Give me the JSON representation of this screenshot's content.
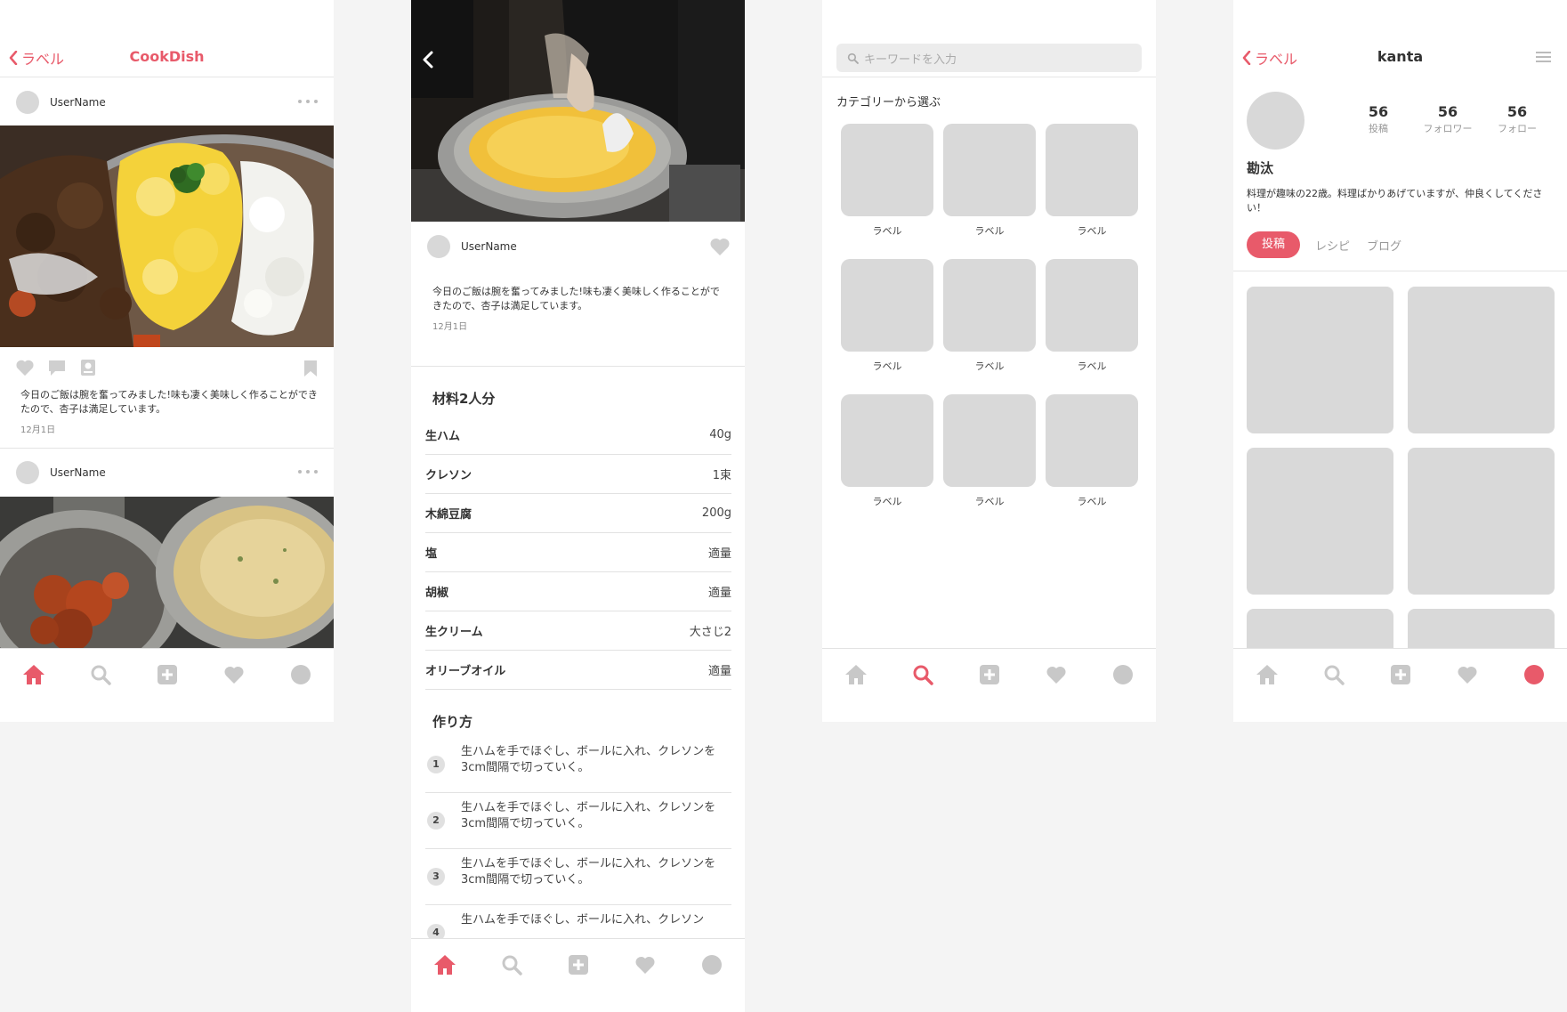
{
  "colors": {
    "accent": "#e85a6a",
    "inactive_icon": "#c8c8c8",
    "placeholder": "#d9d9d9"
  },
  "feed": {
    "back_label": "ラベル",
    "title": "CookDish",
    "posts": [
      {
        "username": "UserName",
        "caption": "今日のご飯は腕を奮ってみました!味も凄く美味しく作ることができたので、杏子は満足しています。",
        "date": "12月1日"
      },
      {
        "username": "UserName"
      }
    ]
  },
  "recipe": {
    "username": "UserName",
    "caption": "今日のご飯は腕を奮ってみました!味も凄く美味しく作ることができたので、杏子は満足しています。",
    "date": "12月1日",
    "ingredients_title": "材料2人分",
    "ingredients": [
      {
        "name": "生ハム",
        "amount": "40g"
      },
      {
        "name": "クレソン",
        "amount": "1束"
      },
      {
        "name": "木綿豆腐",
        "amount": "200g"
      },
      {
        "name": "塩",
        "amount": "適量"
      },
      {
        "name": "胡椒",
        "amount": "適量"
      },
      {
        "name": "生クリーム",
        "amount": "大さじ2"
      },
      {
        "name": "オリーブオイル",
        "amount": "適量"
      }
    ],
    "steps_title": "作り方",
    "steps": [
      {
        "num": "1",
        "text": "生ハムを手でほぐし、ボールに入れ、クレソンを3cm間隔で切っていく。"
      },
      {
        "num": "2",
        "text": "生ハムを手でほぐし、ボールに入れ、クレソンを3cm間隔で切っていく。"
      },
      {
        "num": "3",
        "text": "生ハムを手でほぐし、ボールに入れ、クレソンを3cm間隔で切っていく。"
      },
      {
        "num": "4",
        "text": "生ハムを手でほぐし、ボールに入れ、クレソン"
      }
    ]
  },
  "search": {
    "placeholder": "キーワードを入力",
    "category_title": "カテゴリーから選ぶ",
    "categories": [
      "ラベル",
      "ラベル",
      "ラベル",
      "ラベル",
      "ラベル",
      "ラベル",
      "ラベル",
      "ラベル",
      "ラベル"
    ]
  },
  "profile": {
    "back_label": "ラベル",
    "title": "kanta",
    "stats": [
      {
        "num": "56",
        "label": "投稿"
      },
      {
        "num": "56",
        "label": "フォロワー"
      },
      {
        "num": "56",
        "label": "フォロー"
      }
    ],
    "name": "勘汰",
    "bio": "料理が趣味の22歳。料理ばかりあげていますが、仲良くしてください！",
    "tabs": [
      "投稿",
      "レシピ",
      "ブログ"
    ]
  },
  "tabbar": {
    "icons": [
      "home-icon",
      "search-icon",
      "add-icon",
      "heart-icon",
      "profile-icon"
    ],
    "active": {
      "feed": "home-icon",
      "recipe": "home-icon",
      "search": "search-icon",
      "profile": "profile-icon"
    }
  }
}
